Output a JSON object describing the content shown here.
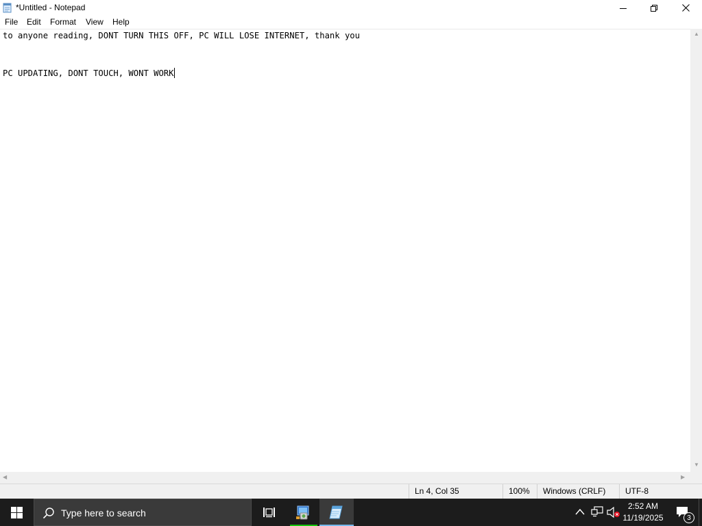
{
  "window": {
    "title": "*Untitled - Notepad",
    "app_icon": "notepad-icon",
    "controls": [
      "minimize-icon",
      "restore-icon",
      "close-icon"
    ]
  },
  "menu": {
    "items": [
      {
        "label": "File"
      },
      {
        "label": "Edit"
      },
      {
        "label": "Format"
      },
      {
        "label": "View"
      },
      {
        "label": "Help"
      }
    ]
  },
  "editor": {
    "lines": [
      "to anyone reading, DONT TURN THIS OFF, PC WILL LOSE INTERNET, thank you",
      "",
      "",
      "PC UPDATING, DONT TOUCH, WONT WORK"
    ]
  },
  "status": {
    "position": "Ln 4, Col 35",
    "zoom": "100%",
    "line_ending": "Windows (CRLF)",
    "encoding": "UTF-8"
  },
  "taskbar": {
    "search_placeholder": "Type here to search",
    "pinned": [
      {
        "icon": "task-view-icon",
        "active": false
      },
      {
        "icon": "control-panel-icon",
        "active": true,
        "indicator_color": "#16c60c"
      },
      {
        "icon": "notepad-icon",
        "active": true,
        "indicator_color": "#76b9ed"
      }
    ],
    "tray": {
      "icons": [
        "chevron-up-icon",
        "network-icon",
        "volume-muted-icon"
      ],
      "time": "2:52 AM",
      "date": "11/19/2025",
      "notification_count": "3"
    }
  },
  "colors": {
    "taskbar_bg": "#1c1c1c",
    "search_bg": "#3a3a3a",
    "statusbar_bg": "#f0f0f0",
    "notepad_indicator": "#76b9ed",
    "control_panel_indicator": "#16c60c",
    "mute_badge": "#e81123"
  }
}
